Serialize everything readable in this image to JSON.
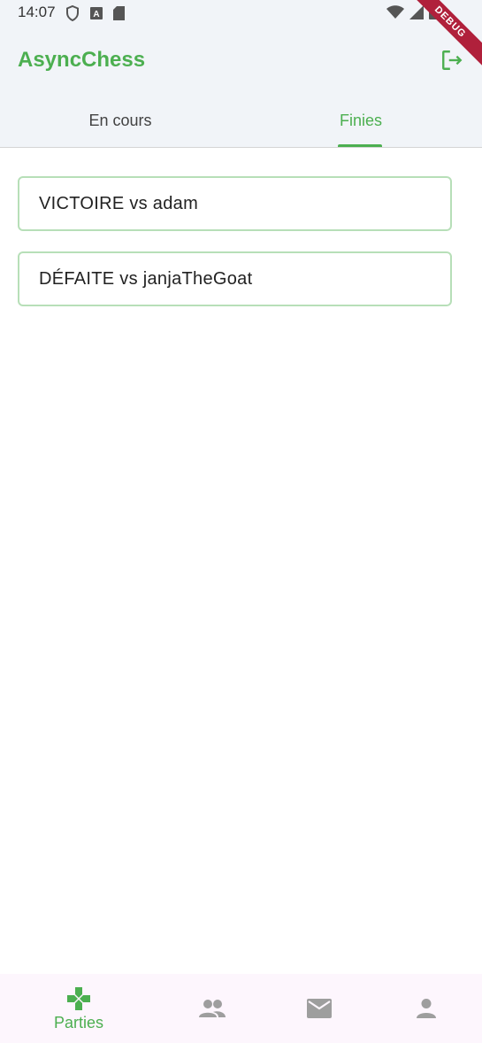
{
  "status_bar": {
    "time": "14:07",
    "left_icons": [
      "shield-icon",
      "a-icon",
      "sd-card-icon"
    ],
    "right_icons": [
      "wifi-icon",
      "signal-icon",
      "battery-icon"
    ]
  },
  "app_bar": {
    "title": "AsyncChess",
    "logout_icon": "logout-icon"
  },
  "debug_banner": "DEBUG",
  "tabs": [
    {
      "label": "En cours",
      "selected": false
    },
    {
      "label": "Finies",
      "selected": true
    }
  ],
  "games": [
    {
      "label": "VICTOIRE vs adam"
    },
    {
      "label": "DÉFAITE vs janjaTheGoat"
    }
  ],
  "bottom_nav": {
    "items": [
      {
        "icon": "gamepad-icon",
        "label": "Parties",
        "selected": true
      },
      {
        "icon": "people-icon",
        "label": "",
        "selected": false
      },
      {
        "icon": "mail-icon",
        "label": "",
        "selected": false
      },
      {
        "icon": "person-icon",
        "label": "",
        "selected": false
      }
    ]
  },
  "colors": {
    "accent": "#4caf50",
    "app_bar_bg": "#f1f4f8",
    "card_border": "#b7dfb8",
    "nav_bg": "#fdf6fd",
    "inactive_icon": "#9e9e9e"
  }
}
